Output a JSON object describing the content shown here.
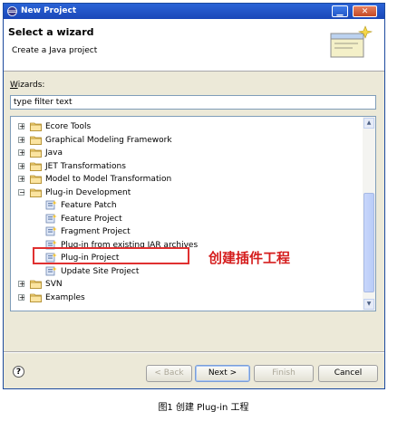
{
  "window": {
    "title": "New Project",
    "min_glyph": "▁",
    "close_glyph": "✕"
  },
  "header": {
    "title": "Select a wizard",
    "description": "Create a Java project",
    "icon": "wizard-banner-icon"
  },
  "wizards_label": {
    "mnemonic": "W",
    "rest": "izards:"
  },
  "filter": {
    "value": "type filter text"
  },
  "tree": {
    "items": [
      {
        "label": "Ecore Tools",
        "kind": "folder",
        "expander": "+"
      },
      {
        "label": "Graphical Modeling Framework",
        "kind": "folder",
        "expander": "+"
      },
      {
        "label": "Java",
        "kind": "folder",
        "expander": "+"
      },
      {
        "label": "JET Transformations",
        "kind": "folder",
        "expander": "+"
      },
      {
        "label": "Model to Model Transformation",
        "kind": "folder",
        "expander": "+"
      },
      {
        "label": "Plug-in Development",
        "kind": "folder",
        "expander": "−"
      },
      {
        "label": "Feature Patch",
        "kind": "wizard"
      },
      {
        "label": "Feature Project",
        "kind": "wizard"
      },
      {
        "label": "Fragment Project",
        "kind": "wizard"
      },
      {
        "label": "Plug-in from existing JAR archives",
        "kind": "wizard"
      },
      {
        "label": "Plug-in Project",
        "kind": "wizard"
      },
      {
        "label": "Update Site Project",
        "kind": "wizard"
      },
      {
        "label": "SVN",
        "kind": "folder",
        "expander": "+"
      },
      {
        "label": "Examples",
        "kind": "folder",
        "expander": "+"
      }
    ]
  },
  "annotation": {
    "text": "创建插件工程",
    "color": "#d51e1e"
  },
  "buttons": {
    "help": "?",
    "back": "< Back",
    "next": "Next >",
    "finish": "Finish",
    "cancel": "Cancel"
  },
  "caption": "图1  创建 Plug-in 工程",
  "colors": {
    "titlebar": "#1a47b8",
    "dialog_bg": "#ece9d8",
    "highlight": "#e03030"
  }
}
